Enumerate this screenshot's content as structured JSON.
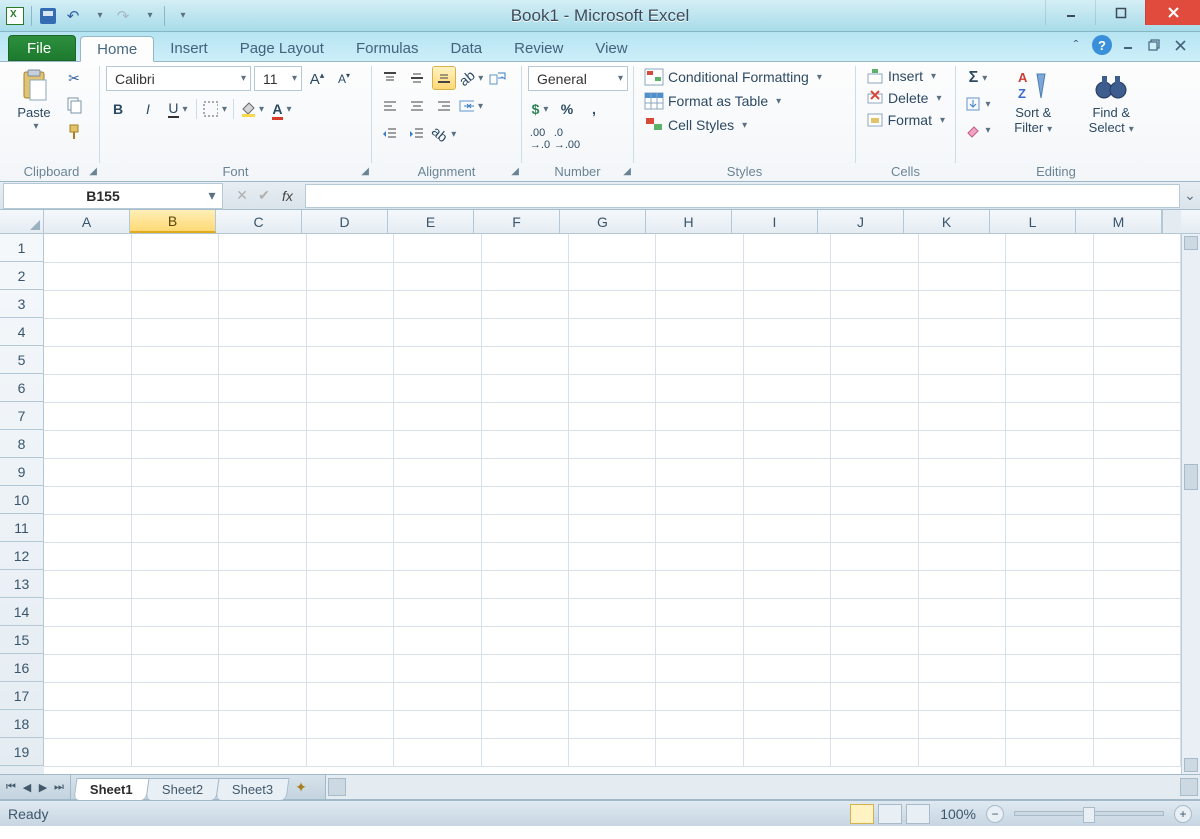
{
  "title": "Book1 - Microsoft Excel",
  "tabs": {
    "file": "File",
    "home": "Home",
    "insert": "Insert",
    "page_layout": "Page Layout",
    "formulas": "Formulas",
    "data": "Data",
    "review": "Review",
    "view": "View"
  },
  "ribbon": {
    "clipboard": {
      "label": "Clipboard",
      "paste": "Paste"
    },
    "font": {
      "label": "Font",
      "name": "Calibri",
      "size": "11"
    },
    "alignment": {
      "label": "Alignment"
    },
    "number": {
      "label": "Number",
      "format": "General"
    },
    "styles": {
      "label": "Styles",
      "conditional": "Conditional Formatting",
      "table": "Format as Table",
      "cell": "Cell Styles"
    },
    "cells": {
      "label": "Cells",
      "insert": "Insert",
      "delete": "Delete",
      "format": "Format"
    },
    "editing": {
      "label": "Editing",
      "sort": "Sort & Filter",
      "find": "Find & Select"
    }
  },
  "formula_bar": {
    "cell_ref": "B155",
    "fx": "fx"
  },
  "columns": [
    "A",
    "B",
    "C",
    "D",
    "E",
    "F",
    "G",
    "H",
    "I",
    "J",
    "K",
    "L",
    "M"
  ],
  "selected_column": "B",
  "rows": [
    1,
    2,
    3,
    4,
    5,
    6,
    7,
    8,
    9,
    10,
    11,
    12,
    13,
    14,
    15,
    16,
    17,
    18,
    19
  ],
  "sheets": {
    "items": [
      "Sheet1",
      "Sheet2",
      "Sheet3"
    ],
    "active": "Sheet1"
  },
  "status": {
    "text": "Ready",
    "zoom": "100%"
  }
}
